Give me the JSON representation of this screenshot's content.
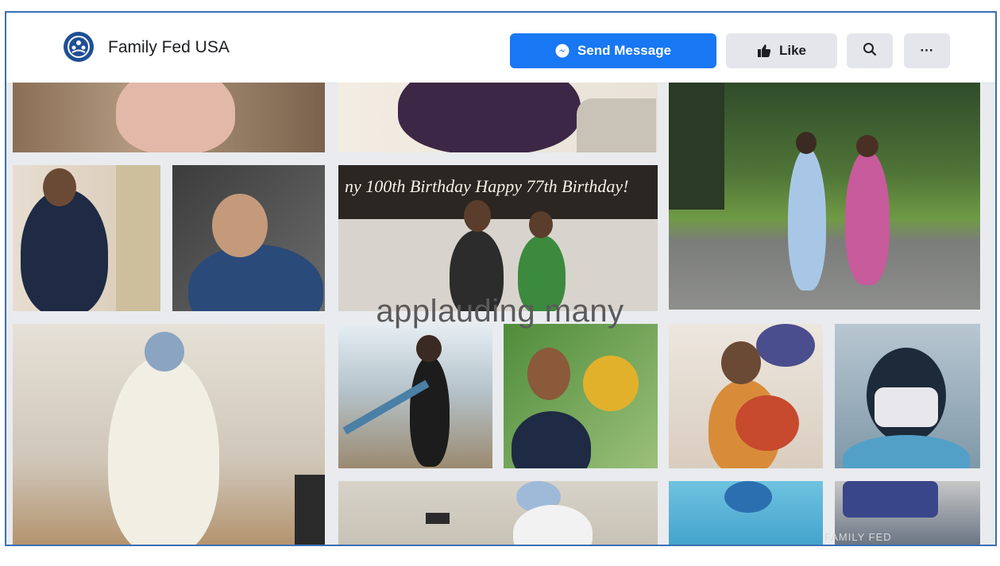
{
  "page": {
    "name": "Family Fed USA"
  },
  "actions": {
    "send_message": "Send Message",
    "like": "Like",
    "more": "···"
  },
  "icons": {
    "logo": "family-fed-emblem-icon",
    "messenger": "messenger-icon",
    "like": "thumbs-up-icon",
    "search": "search-icon",
    "more": "more-icon"
  },
  "colors": {
    "primary": "#1877f2",
    "frame_border": "#3b6fb5"
  },
  "video": {
    "caption": "applauding many",
    "banner": "ny 100th Birthday Happy 77th Birthday!",
    "watermark": "FAMILY FED"
  }
}
